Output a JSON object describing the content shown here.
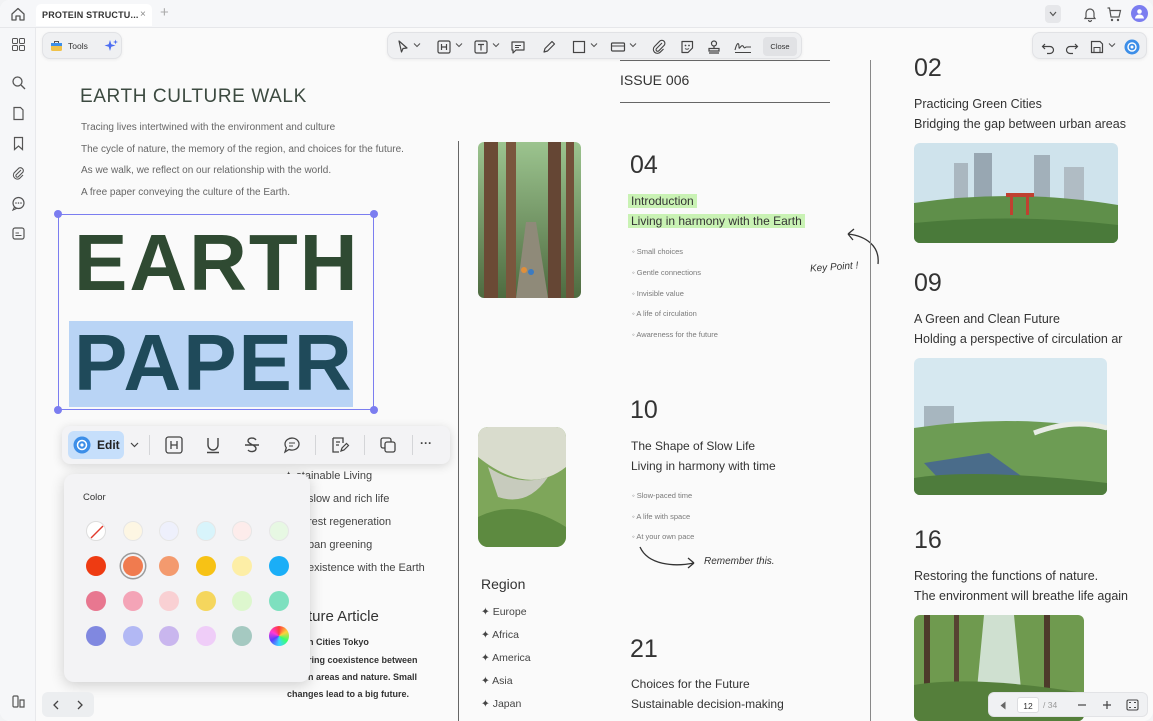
{
  "tab": {
    "title": "PROTEIN STRUCTU...",
    "close": "×",
    "new": "+"
  },
  "toolbar": {
    "tools_label": "Tools",
    "close_label": "Close"
  },
  "page_left": {
    "heading": "EARTH CULTURE WALK",
    "lines": [
      "Tracing lives intertwined with the environment and culture",
      "The cycle of nature, the memory of the region, and choices for the future.",
      "As we walk, we reflect on our relationship with the world.",
      "A free paper conveying the culture of the Earth."
    ],
    "big_word_1": "EARTH",
    "big_word_2": "PAPER",
    "list_partial": [
      "stainable Living",
      "slow and rich life",
      "rest regeneration",
      "ban greening",
      "existence with the Earth"
    ],
    "feature_heading": "ture Article",
    "feature_lines": [
      "n Cities Tokyo",
      "ring coexistence between",
      "n areas and nature. Small",
      "changes lead to a big future."
    ]
  },
  "issue": {
    "label": "ISSUE 006"
  },
  "section_04": {
    "number": "04",
    "title": "Introduction",
    "subtitle": "Living in harmony with the Earth",
    "bullets": [
      "Small choices",
      "Gentle connections",
      "Invisible value",
      "A life of circulation",
      "Awareness for the future"
    ],
    "note": "Key Point !"
  },
  "section_10": {
    "number": "10",
    "title": "The Shape of Slow Life",
    "subtitle": "Living in harmony with time",
    "bullets": [
      "Slow-paced time",
      "A life with space",
      "At your own pace"
    ],
    "note": "Remember this."
  },
  "section_21": {
    "number": "21",
    "title": "Choices for the Future",
    "subtitle": "Sustainable decision-making"
  },
  "region": {
    "heading": "Region",
    "items": [
      "Europe",
      "Africa",
      "America",
      "Asia",
      "Japan"
    ]
  },
  "right_col": {
    "s02": {
      "number": "02",
      "title": "Practicing Green Cities",
      "subtitle": "Bridging the gap between urban areas"
    },
    "s09": {
      "number": "09",
      "title": "A Green and Clean Future",
      "subtitle": "Holding a perspective of circulation ar"
    },
    "s16": {
      "number": "16",
      "title": "Restoring the functions of nature.",
      "subtitle": "The environment will breathe life again"
    }
  },
  "editbar": {
    "edit_label": "Edit",
    "more": "···"
  },
  "color_popup": {
    "title": "Color",
    "rows": [
      [
        "none",
        "#fdf6e3",
        "#eef0fc",
        "#d8f4fb",
        "#fdeceb",
        "#e7f8e3"
      ],
      [
        "#ee3b12",
        "#f07b4f",
        "#f39a6e",
        "#f7c215",
        "#fdeea6",
        "#1aaef7"
      ],
      [
        "#e87790",
        "#f4a4b7",
        "#f9d0d3",
        "#f5d65d",
        "#ddf7ce",
        "#7ee0bf"
      ],
      [
        "#8088e0",
        "#b2b8f4",
        "#c9b6ee",
        "#efcdf8",
        "#a5c9c1",
        "gradient"
      ]
    ],
    "selected_index": [
      1,
      1
    ]
  },
  "pager": {
    "page": "12",
    "total": "/ 34"
  },
  "colors": {
    "accent": "#7b7df0",
    "highlight": "#c9f2b4",
    "earth_text": "#2f4a32",
    "paper_text": "#1f4a5a",
    "paper_bg": "#b9d4f5"
  }
}
